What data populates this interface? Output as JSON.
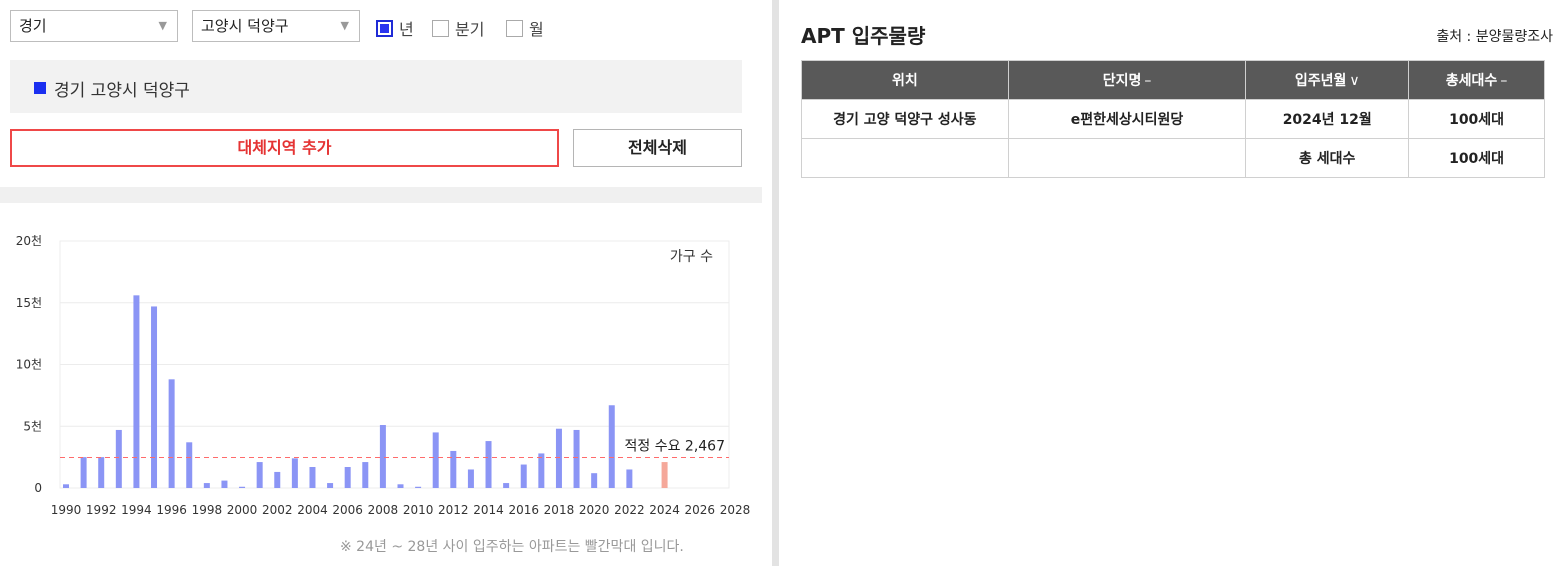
{
  "filters": {
    "province": "경기",
    "district": "고양시 덕양구",
    "period_options": [
      {
        "label": "년",
        "checked": true
      },
      {
        "label": "분기",
        "checked": false
      },
      {
        "label": "월",
        "checked": false
      }
    ]
  },
  "region_legend": {
    "label": "경기 고양시 덕양구",
    "color": "#1a2ff0"
  },
  "buttons": {
    "add_region": "대체지역 추가",
    "delete_all": "전체삭제"
  },
  "chart_data": {
    "type": "bar",
    "unit_label": "가구 수",
    "x": [
      1990,
      1991,
      1992,
      1993,
      1994,
      1995,
      1996,
      1997,
      1998,
      1999,
      2000,
      2001,
      2002,
      2003,
      2004,
      2005,
      2006,
      2007,
      2008,
      2009,
      2010,
      2011,
      2012,
      2013,
      2014,
      2015,
      2016,
      2017,
      2018,
      2019,
      2020,
      2021,
      2022,
      2023,
      2024
    ],
    "values": [
      300,
      2500,
      2500,
      4700,
      15600,
      14700,
      8800,
      3700,
      400,
      600,
      100,
      2100,
      1300,
      2400,
      1700,
      400,
      1700,
      2100,
      5100,
      300,
      100,
      4500,
      3000,
      1500,
      3800,
      400,
      1900,
      2800,
      4800,
      4700,
      1200,
      6700,
      1500,
      0,
      2100
    ],
    "highlight_years": [
      2024
    ],
    "xticks": [
      "1990",
      "1992",
      "1994",
      "1996",
      "1998",
      "2000",
      "2002",
      "2004",
      "2006",
      "2008",
      "2010",
      "2012",
      "2014",
      "2016",
      "2018",
      "2020",
      "2022",
      "2024",
      "2026",
      "2028"
    ],
    "xlim": [
      1990,
      2028
    ],
    "yticks": [
      "0",
      "5천",
      "10천",
      "15천",
      "20천"
    ],
    "ylim": [
      0,
      20000
    ],
    "grid": true,
    "reference_line": {
      "value": 2467,
      "label": "적정 수요 2,467",
      "color": "#ff6b6b"
    },
    "colors": {
      "bar": "#8b95f5",
      "highlight": "#f5a89a"
    }
  },
  "chart_note": "※ 24년 ~ 28년 사이 입주하는 아파트는 빨간막대 입니다.",
  "apt": {
    "title": "APT 입주물량",
    "source": "출처 : 분양물량조사",
    "columns": [
      {
        "label": "위치",
        "sort": ""
      },
      {
        "label": "단지명",
        "sort": "–"
      },
      {
        "label": "입주년월",
        "sort": "∨"
      },
      {
        "label": "총세대수",
        "sort": "–"
      }
    ],
    "rows": [
      [
        "경기 고양 덕양구 성사동",
        "e편한세상시티원당",
        "2024년 12월",
        "100세대"
      ],
      [
        "",
        "",
        "총 세대수",
        "100세대"
      ]
    ]
  }
}
